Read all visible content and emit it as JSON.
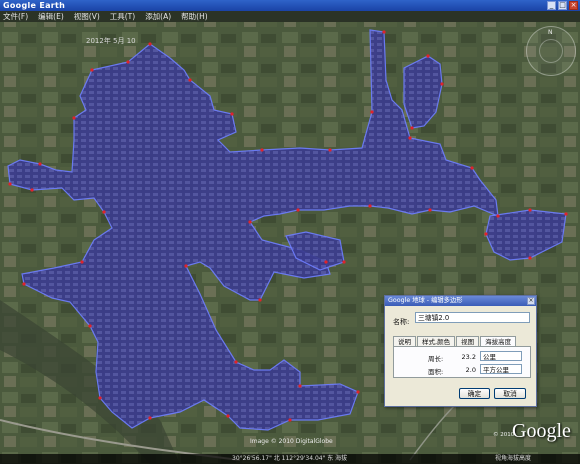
{
  "app": {
    "title": "Google Earth"
  },
  "window_buttons": {
    "minimize": "_",
    "maximize": "□",
    "close": "×"
  },
  "menu": [
    "文件(F)",
    "编辑(E)",
    "视图(V)",
    "工具(T)",
    "添加(A)",
    "帮助(H)"
  ],
  "map": {
    "timestamp": "2012年 5月 10",
    "image_credit": "Image © 2010 DigitalGlobe",
    "copyright": "© 2010",
    "logo": "Google",
    "compass_north": "N"
  },
  "dialog": {
    "title": "Google 地球 - 编辑多边形",
    "close": "×",
    "name_label": "名称:",
    "name_value": "三塘镇2.0",
    "tabs": [
      "说明",
      "样式,颜色",
      "视图",
      "海拔高度"
    ],
    "perimeter_label": "周长:",
    "perimeter_value": "23.2",
    "perimeter_unit": "公里",
    "area_label": "面积:",
    "area_value": "2.0",
    "area_unit": "平方公里",
    "ok": "确定",
    "cancel": "取消"
  },
  "statusbar": {
    "coords": "30°26'56.17\" 北  112°29'34.04\" 东  海拔",
    "eye_alt": "视角海拔高度"
  },
  "colors": {
    "polygon_fill": "#3c3f95",
    "polygon_stroke": "#5a6cff",
    "vertex": "#e0232b",
    "titlebar": "#1a43a6"
  }
}
